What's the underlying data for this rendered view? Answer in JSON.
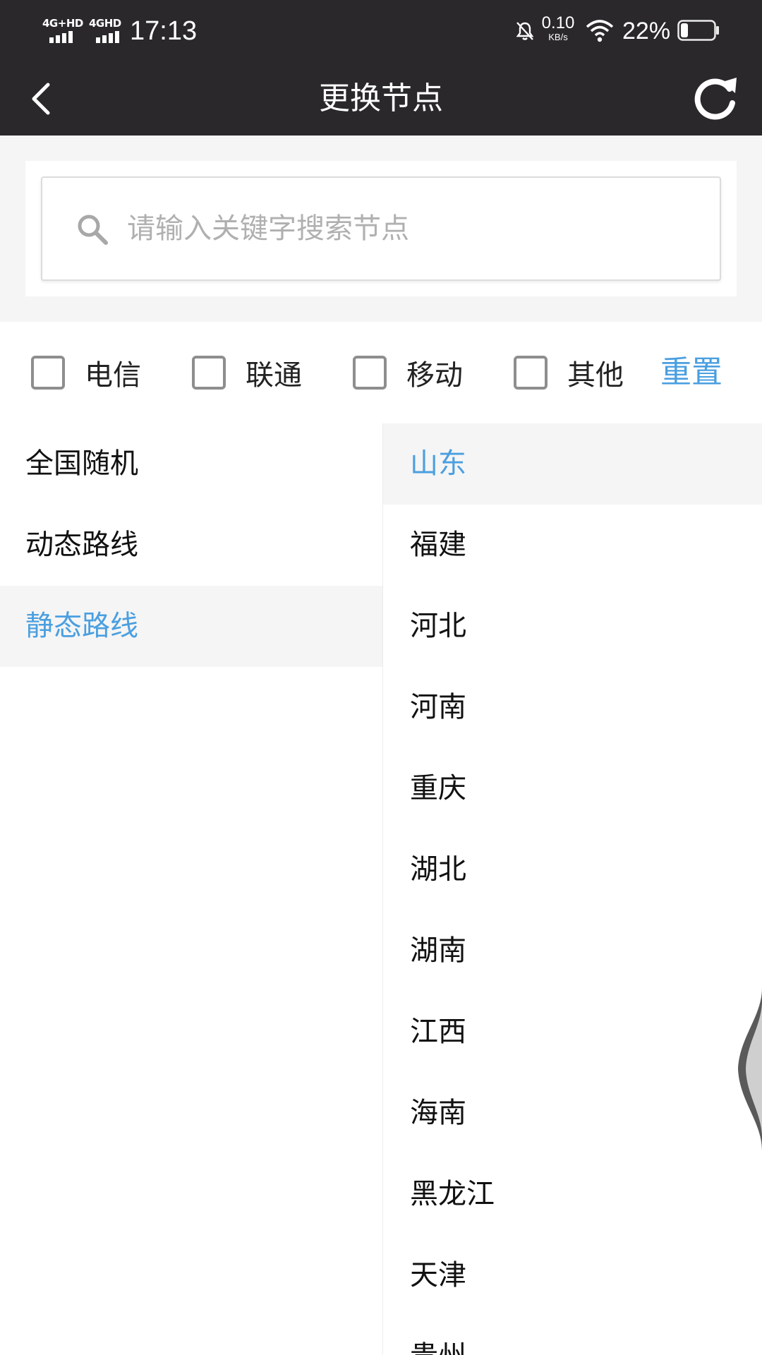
{
  "status_bar": {
    "network_1": "4G+HD",
    "network_2": "4GHD",
    "time": "17:13",
    "speed_value": "0.10",
    "speed_unit": "KB/s",
    "battery": "22%",
    "icons": [
      "signal-icon",
      "bell-off-icon",
      "wifi-icon",
      "battery-icon"
    ]
  },
  "header": {
    "title": "更换节点",
    "back_icon": "chevron-left-icon",
    "refresh_icon": "refresh-icon"
  },
  "search": {
    "placeholder": "请输入关键字搜索节点",
    "value": "",
    "icon": "search-icon"
  },
  "filters": {
    "options": [
      {
        "label": "电信",
        "checked": false
      },
      {
        "label": "联通",
        "checked": false
      },
      {
        "label": "移动",
        "checked": false
      },
      {
        "label": "其他",
        "checked": false
      }
    ],
    "reset_label": "重置"
  },
  "left_menu": {
    "items": [
      {
        "label": "全国随机"
      },
      {
        "label": "动态路线"
      },
      {
        "label": "静态路线"
      }
    ],
    "active_index": 2
  },
  "right_menu": {
    "items": [
      {
        "label": "山东"
      },
      {
        "label": "福建"
      },
      {
        "label": "河北"
      },
      {
        "label": "河南"
      },
      {
        "label": "重庆"
      },
      {
        "label": "湖北"
      },
      {
        "label": "湖南"
      },
      {
        "label": "江西"
      },
      {
        "label": "海南"
      },
      {
        "label": "黑龙江"
      },
      {
        "label": "天津"
      },
      {
        "label": "贵州"
      }
    ],
    "active_index": 0
  },
  "colors": {
    "header_bg": "#2a282b",
    "accent": "#4a9fe0",
    "panel_bg": "#f5f5f5",
    "checkbox_border": "#8e8e8e"
  }
}
